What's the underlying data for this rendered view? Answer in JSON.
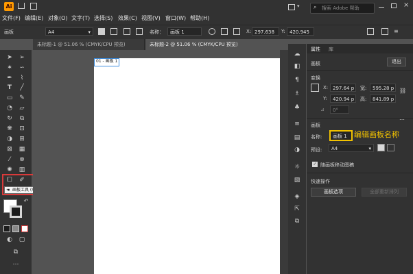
{
  "app": {
    "logo": "Ai"
  },
  "menu": [
    "文件(F)",
    "编辑(E)",
    "对象(O)",
    "文字(T)",
    "选择(S)",
    "效果(C)",
    "视图(V)",
    "窗口(W)",
    "帮助(H)"
  ],
  "search": {
    "placeholder": "搜索 Adobe 帮助"
  },
  "control_bar": {
    "mode_label": "画板",
    "preset": "A4",
    "name_label": "名称：",
    "name_value": "画板 1",
    "x_label": "X:",
    "x_value": "297.638",
    "y_label": "Y:",
    "y_value": "420.945"
  },
  "tabs": [
    {
      "label": "未标题-1 @ 51.06 % (CMYK/CPU 预览)",
      "active": false
    },
    {
      "label": "未标题-2 @ 51.06 % (CMYK/CPU 预览)",
      "active": true
    }
  ],
  "tooltip": "画板工具 (Shift+O)",
  "artboard": {
    "label": "01 - 画板 1"
  },
  "panel": {
    "tabs": [
      "属性",
      "库"
    ],
    "section_artboard": "画板",
    "exit_button": "退出",
    "transform": "变换",
    "x_label": "X:",
    "x": "297.64 p",
    "y_label": "Y:",
    "y": "420.94 p",
    "w_label": "宽:",
    "w": "595.28 p",
    "h_label": "高:",
    "h": "841.89 p",
    "angle": "0°",
    "artboard_section": "画板",
    "name_label": "名称:",
    "name_value": "画板 1",
    "annotation": "编辑画板名称",
    "preset_label": "预设:",
    "preset_value": "A4",
    "move_with_artboard": "随画板移动图稿",
    "quick_actions": "快速操作",
    "options_button": "画板选项",
    "rearrange_button": "全部重新排列"
  },
  "colors": {
    "highlight": "#d93a3a",
    "annotation": "#f2c200",
    "accent": "#ff9a00"
  }
}
